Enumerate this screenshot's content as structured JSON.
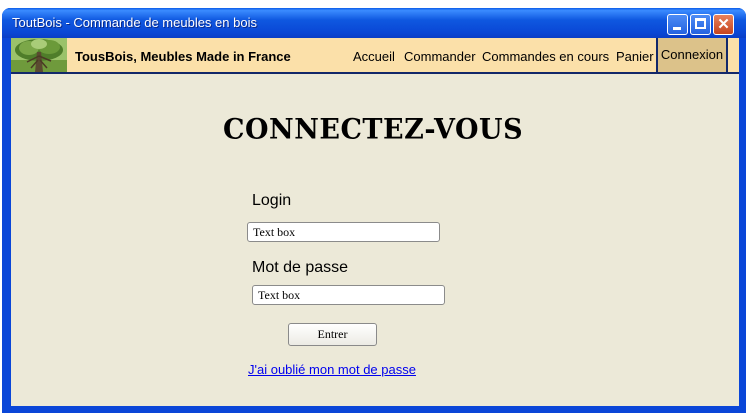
{
  "window": {
    "title": "ToutBois - Commande de meubles en bois",
    "accent_color": "#0a46d8"
  },
  "navbar": {
    "brand": "TousBois, Meubles Made in France",
    "logo_icon": "tree-logo",
    "items": [
      {
        "label": "Accueil"
      },
      {
        "label": "Commander"
      },
      {
        "label": "Commandes en cours"
      },
      {
        "label": "Panier"
      },
      {
        "label": "Connexion",
        "active": true
      }
    ]
  },
  "main": {
    "title": "CONNECTEZ-VOUS",
    "login_label": "Login",
    "login_value": "Text box",
    "password_label": "Mot de passe",
    "password_value": "Text box",
    "submit_label": "Entrer",
    "forgot_link": "J'ai oublié mon mot de passe"
  }
}
